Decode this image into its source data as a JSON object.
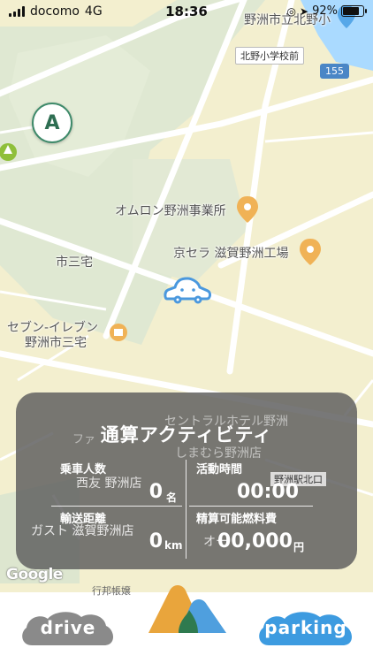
{
  "status_bar": {
    "carrier": "docomo",
    "network": "4G",
    "time": "18:36",
    "battery_percent": "92%",
    "battery_level": 0.92
  },
  "map": {
    "labels": {
      "school": "野洲市立北野小",
      "bus_stop": "北野小学校前",
      "route": "155",
      "omron": "オムロン野洲事業所",
      "kyocera": "京セラ 滋賀野洲工場",
      "sanyake": "市三宅",
      "seven": "セブン-イレブン",
      "seven_branch": "野洲市三宅",
      "hotel": "セントラルホテル野洲",
      "fami": "ファ",
      "shimamura": "しまむら野洲店",
      "nishimatsuya": "西友 野洲店",
      "station": "野洲駅北口",
      "gusto": "ガスト 滋賀野洲店",
      "other": "オー",
      "bottom_hint": "行邦帳嬢"
    },
    "compass_letter": "A",
    "attribution": "Google"
  },
  "activity_panel": {
    "title": "通算アクティビティ",
    "passengers_label": "乗車人数",
    "passengers_value": "0",
    "passengers_unit": "名",
    "active_time_label": "活動時間",
    "active_time_value": "00:00",
    "distance_label": "輸送距離",
    "distance_value": "0",
    "distance_unit": "km",
    "fuel_label": "精算可能燃料費",
    "fuel_value": "00,000",
    "fuel_unit": "円"
  },
  "tabbar": {
    "drive_label": "drive",
    "parking_label": "parking"
  },
  "colors": {
    "drive_cloud": "#8a8a8a",
    "parking_cloud": "#3d9be0",
    "panel": "#626262",
    "logo_orange": "#e9a53c",
    "logo_blue": "#4f9fde",
    "logo_green": "#2f7a4f"
  }
}
